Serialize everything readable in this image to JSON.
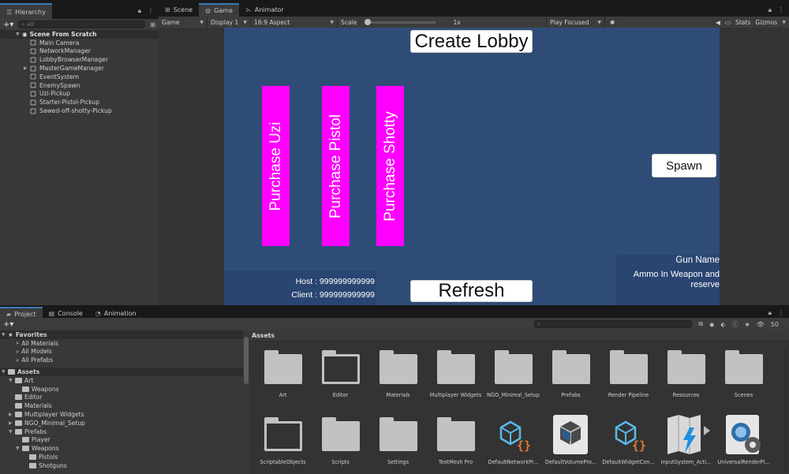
{
  "hierarchy": {
    "tab_label": "Hierarchy",
    "search_placeholder": "All",
    "scene": "Scene From Scratch",
    "items": [
      {
        "label": "Main Camera",
        "expandable": false
      },
      {
        "label": "NetworkManager",
        "expandable": false
      },
      {
        "label": "LobbyBrowserManager",
        "expandable": false
      },
      {
        "label": "MasterGameManager",
        "expandable": true
      },
      {
        "label": "EventSystem",
        "expandable": false
      },
      {
        "label": "EnemySpawn",
        "expandable": false
      },
      {
        "label": "Uzi-Pickup",
        "expandable": false
      },
      {
        "label": "Starter-Pistol-Pickup",
        "expandable": false
      },
      {
        "label": "Sawed-off-shotty-Pickup",
        "expandable": false
      }
    ]
  },
  "view_tabs": [
    {
      "label": "Scene",
      "icon": "grid-icon",
      "active": false
    },
    {
      "label": "Game",
      "icon": "gamepad-icon",
      "active": true
    },
    {
      "label": "Animator",
      "icon": "animator-icon",
      "active": false
    }
  ],
  "game_toolbar": {
    "mode": "Game",
    "display": "Display 1",
    "aspect": "16:9 Aspect",
    "scale_label": "Scale",
    "scale_value": "1x",
    "play_mode": "Play Focused",
    "stats": "Stats",
    "gizmos": "Gizmos"
  },
  "game": {
    "create_lobby": "Create Lobby",
    "refresh": "Refresh",
    "spawn": "Spawn",
    "purchase_buttons": [
      "Purchase Uzi",
      "Purchase Pistol",
      "Purchase Shotty"
    ],
    "host": "Host : 999999999999",
    "client": "Client : 999999999999",
    "gun_name": "Gun Name",
    "ammo": "Ammo In Weapon and reserve",
    "colors": {
      "background": "#2f4c77",
      "purchase": "#ff00ff",
      "button": "#ffffff"
    }
  },
  "project": {
    "tabs": [
      {
        "label": "Project",
        "icon": "folder-icon",
        "active": true
      },
      {
        "label": "Console",
        "icon": "console-icon",
        "active": false
      },
      {
        "label": "Animation",
        "icon": "animation-icon",
        "active": false
      }
    ],
    "hidden_count": "50",
    "favorites": {
      "label": "Favorites",
      "items": [
        "All Materials",
        "All Models",
        "All Prefabs"
      ]
    },
    "assets_tree": {
      "label": "Assets",
      "items": [
        {
          "label": "Art",
          "depth": 1,
          "expanded": true
        },
        {
          "label": "Weapons",
          "depth": 2,
          "expanded": false
        },
        {
          "label": "Editor",
          "depth": 1,
          "expanded": false
        },
        {
          "label": "Materials",
          "depth": 1,
          "expanded": false
        },
        {
          "label": "Multiplayer Widgets",
          "depth": 1,
          "expanded": false,
          "expandable": true
        },
        {
          "label": "NGO_Minimal_Setup",
          "depth": 1,
          "expanded": false,
          "expandable": true
        },
        {
          "label": "Prefabs",
          "depth": 1,
          "expanded": true
        },
        {
          "label": "Player",
          "depth": 2,
          "expanded": false
        },
        {
          "label": "Weapons",
          "depth": 2,
          "expanded": true
        },
        {
          "label": "Pistols",
          "depth": 3,
          "expanded": false
        },
        {
          "label": "Shotguns",
          "depth": 3,
          "expanded": false
        }
      ]
    },
    "breadcrumb": "Assets",
    "grid": [
      {
        "label": "Art",
        "icon": "folder-icon"
      },
      {
        "label": "Editor",
        "icon": "empty-folder-icon"
      },
      {
        "label": "Materials",
        "icon": "folder-icon"
      },
      {
        "label": "Multiplayer Widgets",
        "icon": "folder-icon"
      },
      {
        "label": "NGO_Minimal_Setup",
        "icon": "folder-icon"
      },
      {
        "label": "Prefabs",
        "icon": "folder-icon"
      },
      {
        "label": "Render Pipeline",
        "icon": "folder-icon"
      },
      {
        "label": "Resources",
        "icon": "folder-icon"
      },
      {
        "label": "Scenes",
        "icon": "folder-icon"
      },
      {
        "label": "ScriptableObjects",
        "icon": "empty-folder-icon"
      },
      {
        "label": "Scripts",
        "icon": "folder-icon"
      },
      {
        "label": "Settings",
        "icon": "folder-icon"
      },
      {
        "label": "TextMesh Pro",
        "icon": "folder-icon"
      },
      {
        "label": "DefaultNetworkPr...",
        "icon": "scriptable-asset-icon"
      },
      {
        "label": "DefaultVolumePro...",
        "icon": "volume-profile-icon"
      },
      {
        "label": "DefaultWidgetCon...",
        "icon": "scriptable-asset-icon"
      },
      {
        "label": "InputSystem_Acti...",
        "icon": "input-actions-icon"
      },
      {
        "label": "UniversalRenderPi...",
        "icon": "render-pipeline-asset-icon"
      }
    ]
  }
}
